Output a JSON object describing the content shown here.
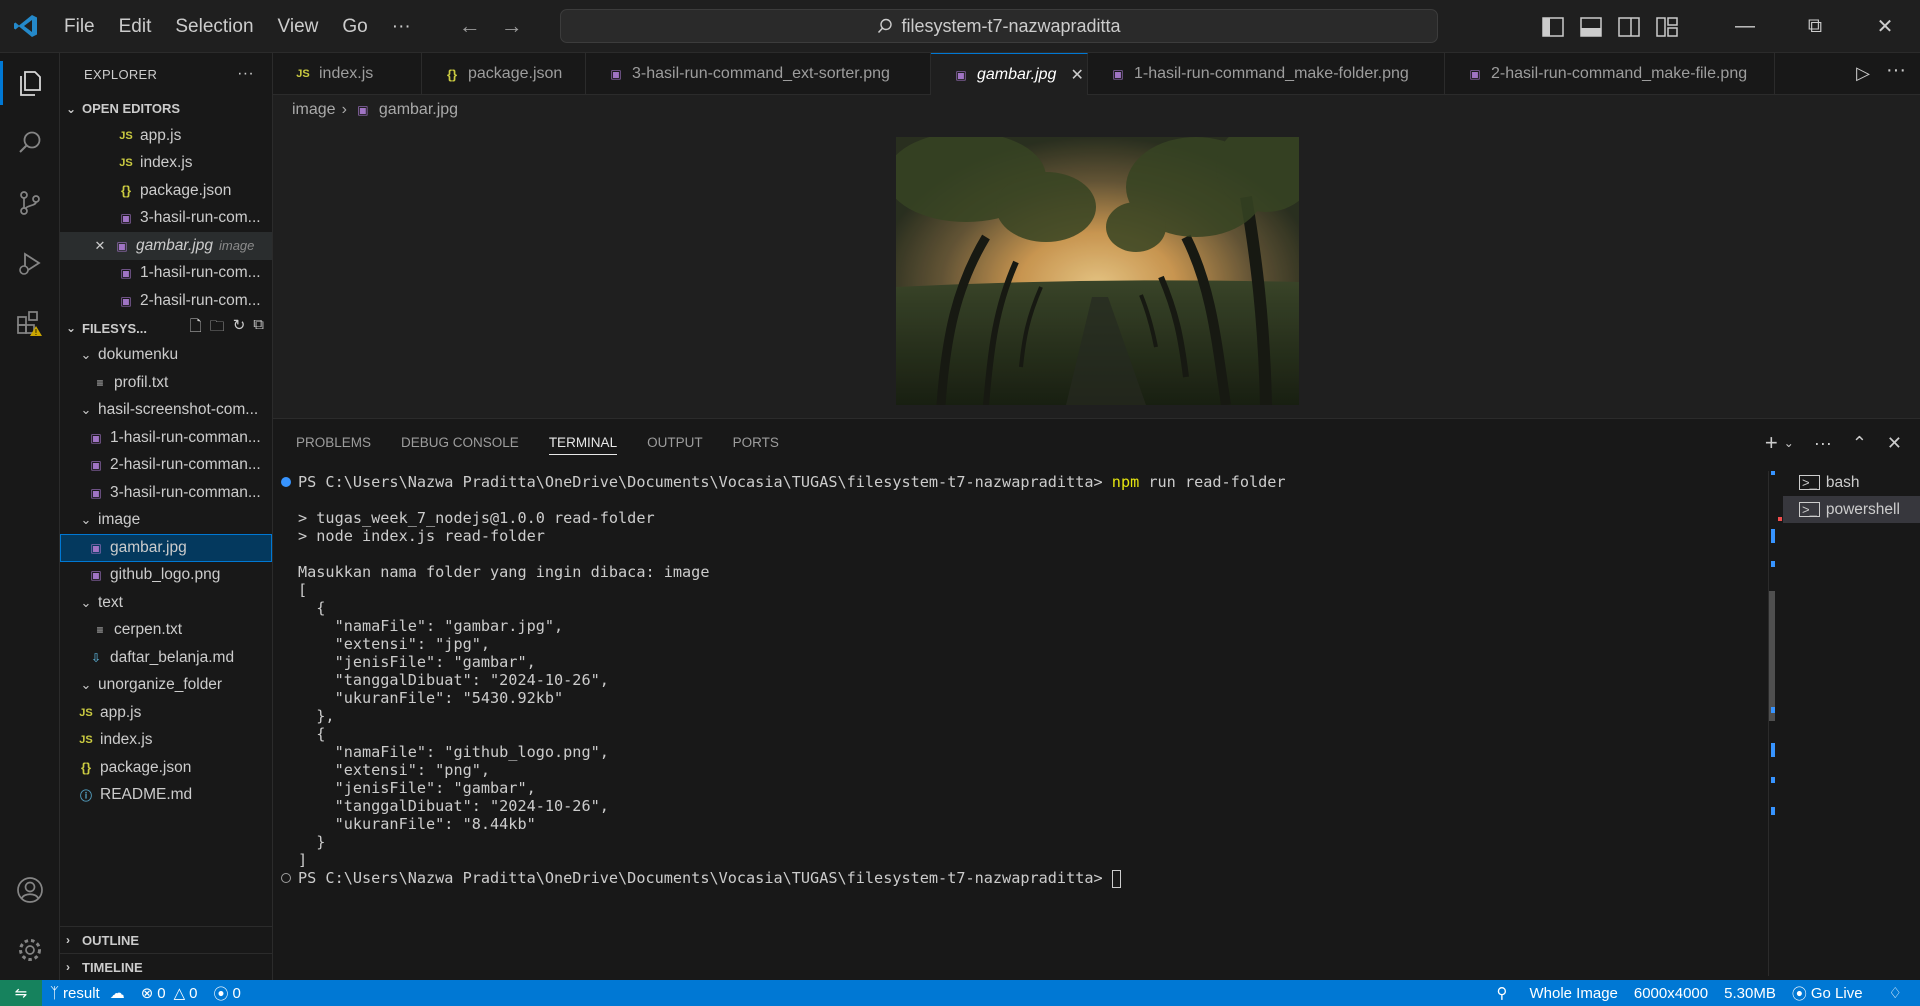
{
  "titlebar": {
    "menus": [
      "File",
      "Edit",
      "Selection",
      "View",
      "Go",
      "···"
    ],
    "search_text": "filesystem-t7-nazwapradittа"
  },
  "sidebar": {
    "explorer_title": "EXPLORER",
    "open_editors_title": "OPEN EDITORS",
    "open_editors": [
      {
        "label": "app.js",
        "icon": "js-file-icon"
      },
      {
        "label": "index.js",
        "icon": "js-file-icon"
      },
      {
        "label": "package.json",
        "icon": "json-file-icon"
      },
      {
        "label": "3-hasil-run-com...",
        "icon": "image-file-icon"
      },
      {
        "label": "gambar.jpg",
        "icon": "image-file-icon",
        "desc": "image"
      },
      {
        "label": "1-hasil-run-com...",
        "icon": "image-file-icon"
      },
      {
        "label": "2-hasil-run-com...",
        "icon": "image-file-icon"
      }
    ],
    "folder_title": "FILESYS...",
    "tree": [
      "dokumenku",
      "profil.txt",
      "hasil-screenshot-com...",
      "1-hasil-run-comman...",
      "2-hasil-run-comman...",
      "3-hasil-run-comman...",
      "image",
      "gambar.jpg",
      "github_logo.png",
      "text",
      "cerpen.txt",
      "daftar_belanja.md",
      "unorganize_folder",
      "app.js",
      "index.js",
      "package.json",
      "README.md"
    ],
    "outline_title": "OUTLINE",
    "timeline_title": "TIMELINE"
  },
  "tabs": [
    {
      "label": "index.js"
    },
    {
      "label": "package.json"
    },
    {
      "label": "3-hasil-run-command_ext-sorter.png"
    },
    {
      "label": "gambar.jpg"
    },
    {
      "label": "1-hasil-run-command_make-folder.png"
    },
    {
      "label": "2-hasil-run-command_make-file.png"
    }
  ],
  "breadcrumb": {
    "folder": "image",
    "file": "gambar.jpg"
  },
  "panel": {
    "tabs": [
      "PROBLEMS",
      "DEBUG CONSOLE",
      "TERMINAL",
      "OUTPUT",
      "PORTS"
    ],
    "terminals": [
      "bash",
      "powershell"
    ],
    "prompt": "PS C:\\Users\\Nazwa Praditta\\OneDrive\\Documents\\Vocasia\\TUGAS\\filesystem-t7-nazwapraditta> ",
    "command_npm": "npm",
    "command_rest": " run read-folder",
    "lines": [
      "> tugas_week_7_nodejs@1.0.0 read-folder",
      "> node index.js read-folder",
      "Masukkan nama folder yang ingin dibaca: image",
      "[",
      "  {",
      "    \"namaFile\": \"gambar.jpg\",",
      "    \"extensi\": \"jpg\",",
      "    \"jenisFile\": \"gambar\",",
      "    \"tanggalDibuat\": \"2024-10-26\",",
      "    \"ukuranFile\": \"5430.92kb\"",
      "  },",
      "  {",
      "    \"namaFile\": \"github_logo.png\",",
      "    \"extensi\": \"png\",",
      "    \"jenisFile\": \"gambar\",",
      "    \"tanggalDibuat\": \"2024-10-26\",",
      "    \"ukuranFile\": \"8.44kb\"",
      "  }",
      "]"
    ]
  },
  "statusbar": {
    "branch": "result",
    "errors": "0",
    "warnings": "0",
    "ports": "0",
    "zoom": "Whole Image",
    "dimensions": "6000x4000",
    "size": "5.30MB",
    "golive": "Go Live"
  }
}
